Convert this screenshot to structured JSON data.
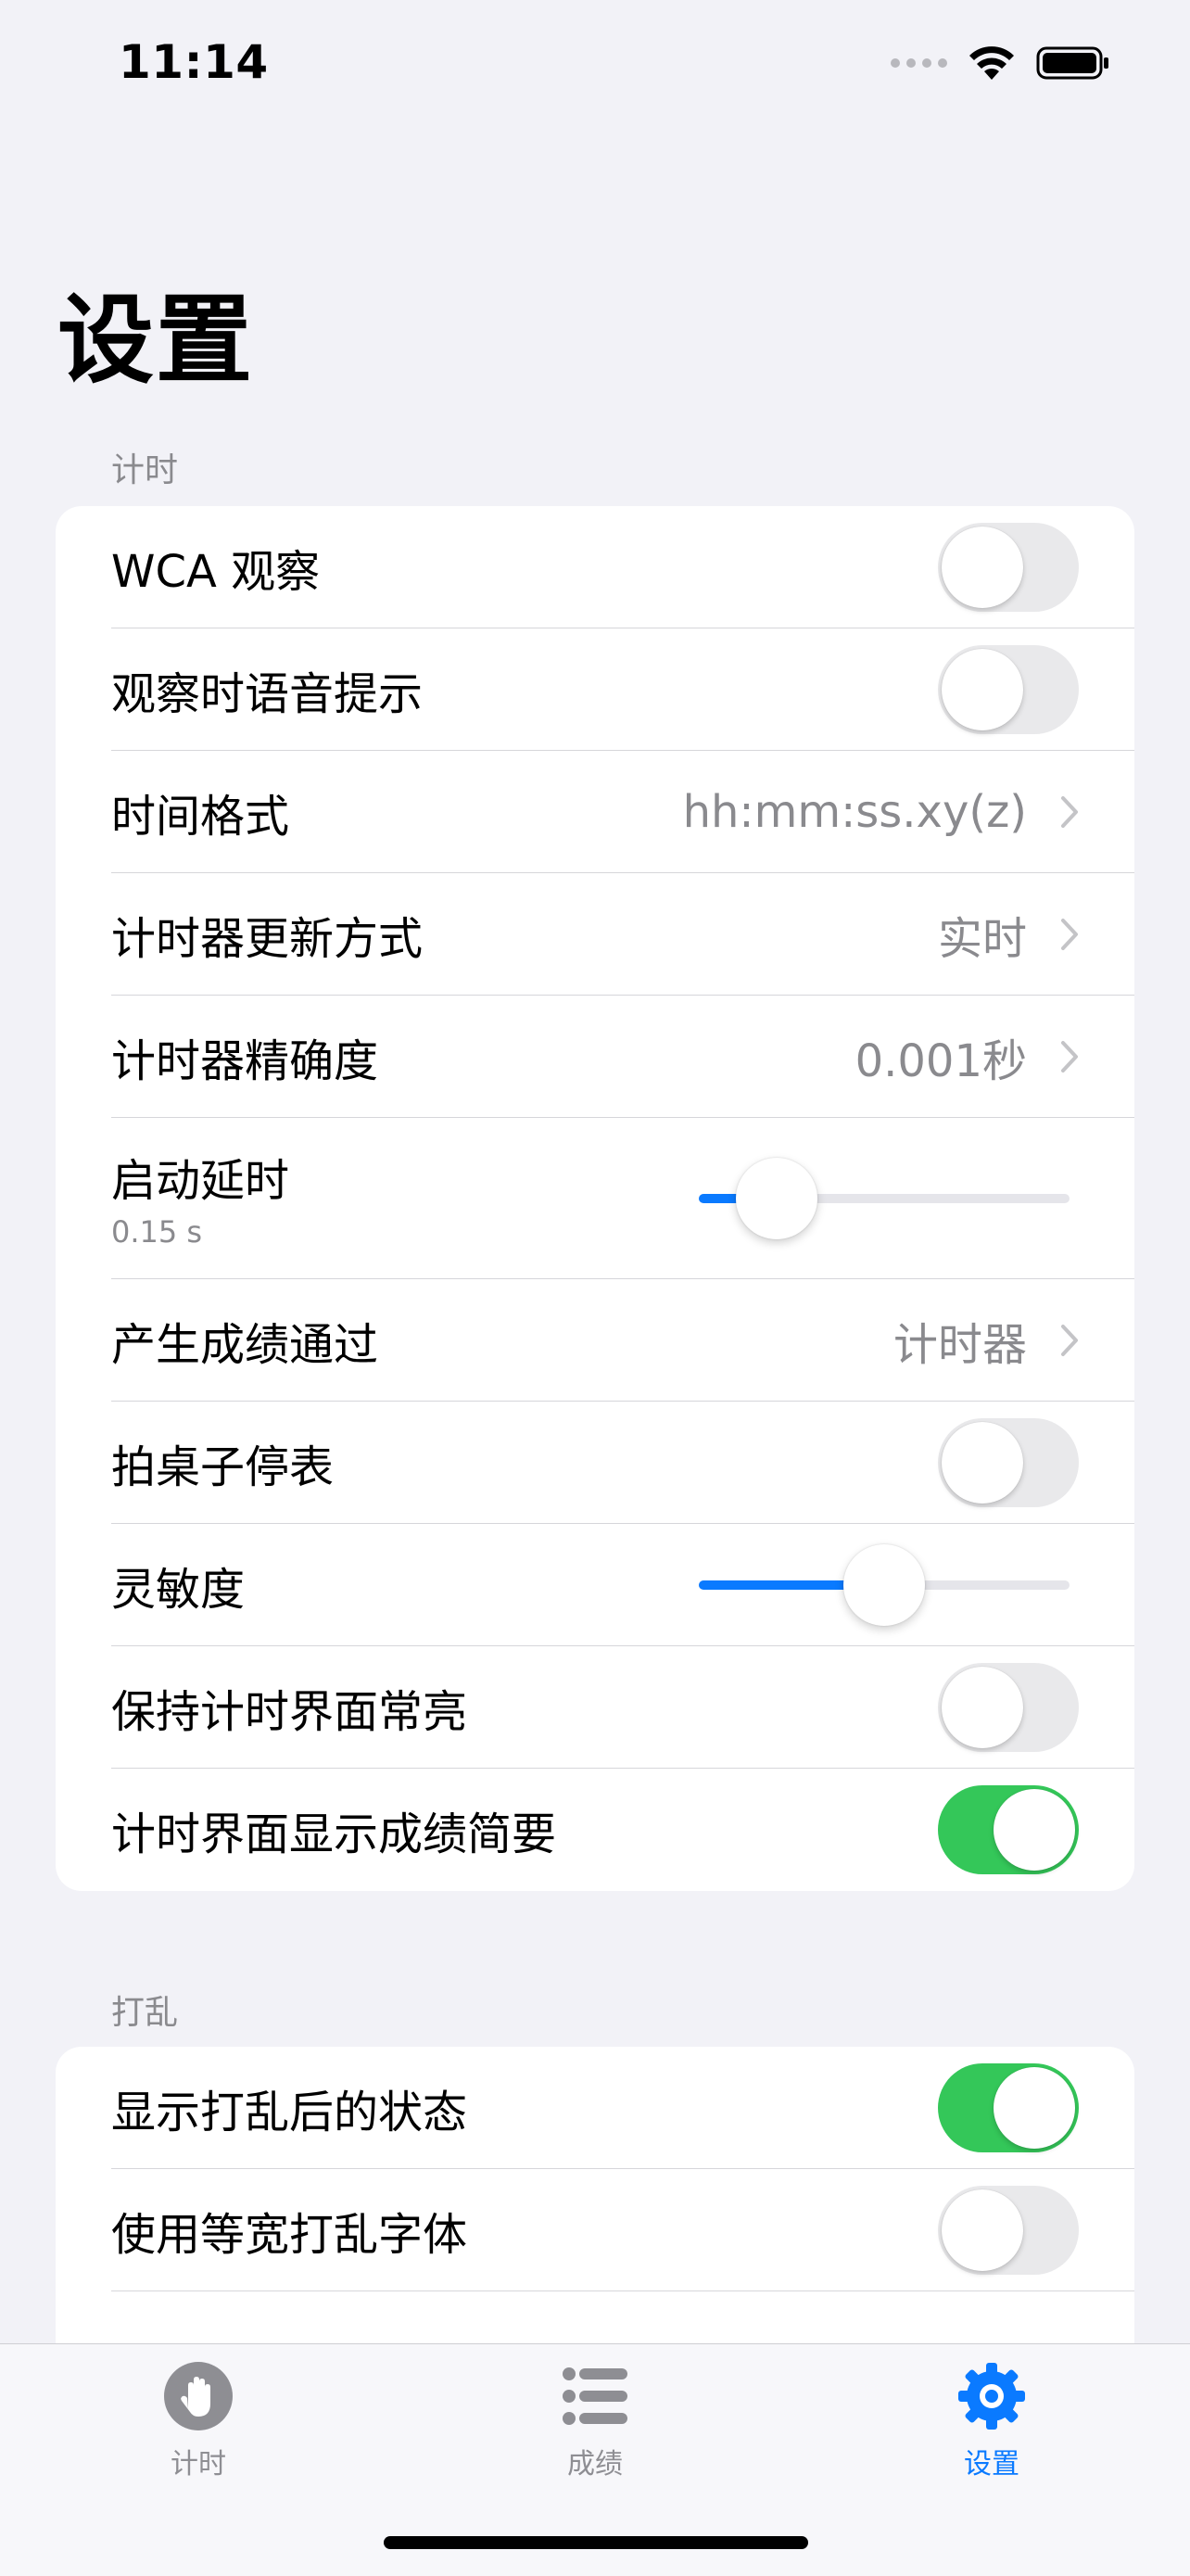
{
  "status_bar": {
    "time": "11:14"
  },
  "page": {
    "title": "设置"
  },
  "sections": [
    {
      "header": "计时",
      "rows": [
        {
          "label": "WCA 观察",
          "type": "toggle",
          "on": false
        },
        {
          "label": "观察时语音提示",
          "type": "toggle",
          "on": false
        },
        {
          "label": "时间格式",
          "type": "nav",
          "value": "hh:mm:ss.xy(z)"
        },
        {
          "label": "计时器更新方式",
          "type": "nav",
          "value": "实时"
        },
        {
          "label": "计时器精确度",
          "type": "nav",
          "value": "0.001秒"
        },
        {
          "label": "启动延时",
          "type": "slider",
          "sublabel": "0.15 s",
          "fraction": 0.21
        },
        {
          "label": "产生成绩通过",
          "type": "nav",
          "value": "计时器"
        },
        {
          "label": "拍桌子停表",
          "type": "toggle",
          "on": false
        },
        {
          "label": "灵敏度",
          "type": "slider",
          "fraction": 0.5
        },
        {
          "label": "保持计时界面常亮",
          "type": "toggle",
          "on": false
        },
        {
          "label": "计时界面显示成绩简要",
          "type": "toggle",
          "on": true
        }
      ]
    },
    {
      "header": "打乱",
      "rows": [
        {
          "label": "显示打乱后的状态",
          "type": "toggle",
          "on": true
        },
        {
          "label": "使用等宽打乱字体",
          "type": "toggle",
          "on": false
        }
      ]
    }
  ],
  "tabbar": {
    "tabs": [
      {
        "label": "计时",
        "icon": "hand-icon",
        "active": false
      },
      {
        "label": "成绩",
        "icon": "list-icon",
        "active": false
      },
      {
        "label": "设置",
        "icon": "gear-icon",
        "active": true
      }
    ]
  },
  "colors": {
    "accent": "#0a7aff",
    "toggle_on": "#34c759",
    "background": "#f2f2f7"
  }
}
